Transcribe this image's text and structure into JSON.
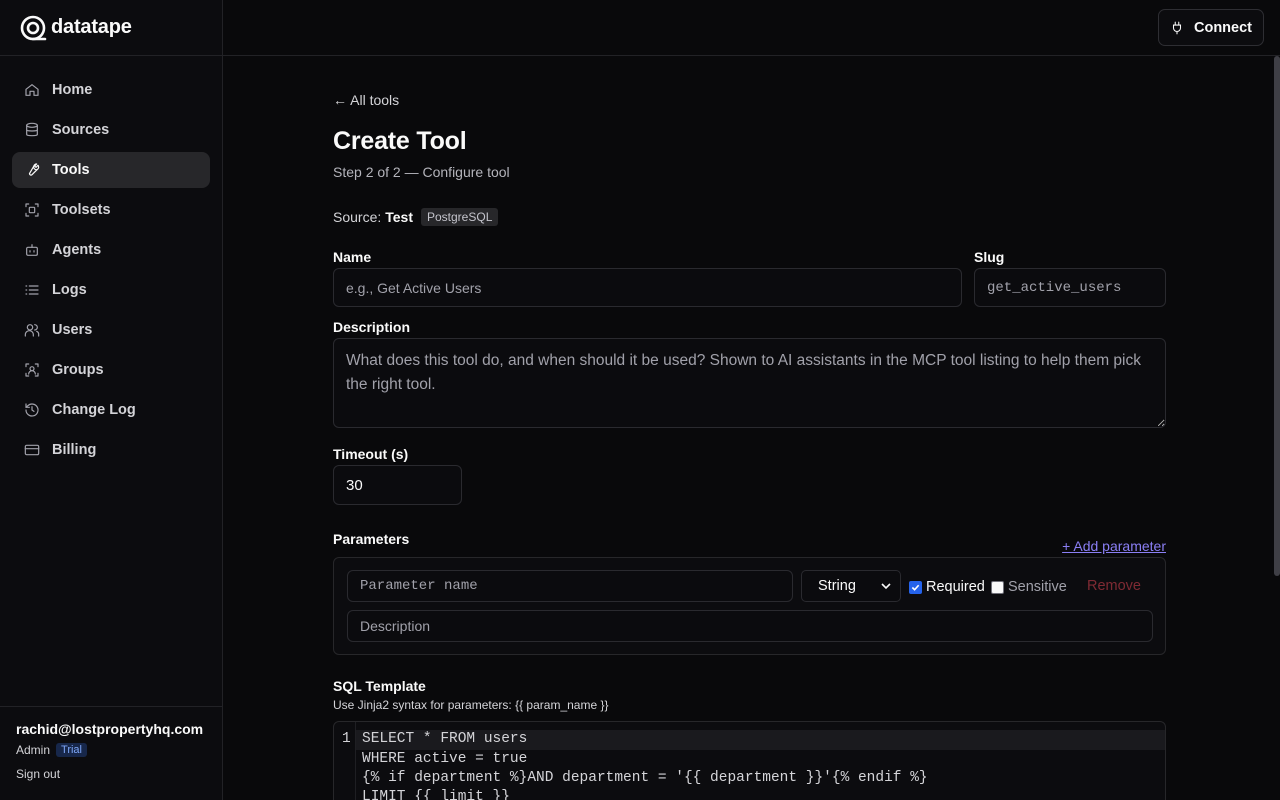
{
  "app": {
    "name": "datatape"
  },
  "sidebar": {
    "items": [
      {
        "label": "Home",
        "icon": "home-icon"
      },
      {
        "label": "Sources",
        "icon": "database-icon"
      },
      {
        "label": "Tools",
        "icon": "wrench-icon",
        "active": true
      },
      {
        "label": "Toolsets",
        "icon": "toolset-icon"
      },
      {
        "label": "Agents",
        "icon": "bot-icon"
      },
      {
        "label": "Logs",
        "icon": "list-icon"
      },
      {
        "label": "Users",
        "icon": "users-icon"
      },
      {
        "label": "Groups",
        "icon": "group-icon"
      },
      {
        "label": "Change Log",
        "icon": "history-icon"
      },
      {
        "label": "Billing",
        "icon": "credit-card-icon"
      }
    ],
    "user": {
      "email": "rachid@lostpropertyhq.com",
      "role": "Admin",
      "plan_badge": "Trial",
      "sign_out": "Sign out"
    }
  },
  "header": {
    "connect_label": "Connect"
  },
  "page": {
    "back_label": "← All tools",
    "title": "Create Tool",
    "subtitle": "Step 2 of 2 — Configure tool",
    "source_prefix": "Source:",
    "source_name": "Test",
    "source_type": "PostgreSQL"
  },
  "form": {
    "name_label": "Name",
    "name_placeholder": "e.g., Get Active Users",
    "slug_label": "Slug",
    "slug_placeholder": "get_active_users",
    "description_label": "Description",
    "description_placeholder": "What does this tool do, and when should it be used? Shown to AI assistants in the MCP tool listing to help them pick the right tool.",
    "timeout_label": "Timeout (s)",
    "timeout_value": "30",
    "parameters_label": "Parameters",
    "add_parameter_label": "+ Add parameter",
    "param": {
      "name_placeholder": "Parameter name",
      "type_value": "String",
      "required_label": "Required",
      "required_checked": true,
      "sensitive_label": "Sensitive",
      "sensitive_checked": false,
      "remove_label": "Remove",
      "description_placeholder": "Description"
    },
    "sql_label": "SQL Template",
    "sql_hint": "Use Jinja2 syntax for parameters: {{ param_name }}",
    "sql_lines": [
      "SELECT * FROM users",
      "WHERE active = true",
      "{% if department %}AND department = '{{ department }}'{% endif %}",
      "LIMIT {{ limit }}"
    ],
    "line_number": "1"
  },
  "colors": {
    "accent": "#8b7ff5",
    "danger": "#7f2a33",
    "background": "#09090b"
  }
}
